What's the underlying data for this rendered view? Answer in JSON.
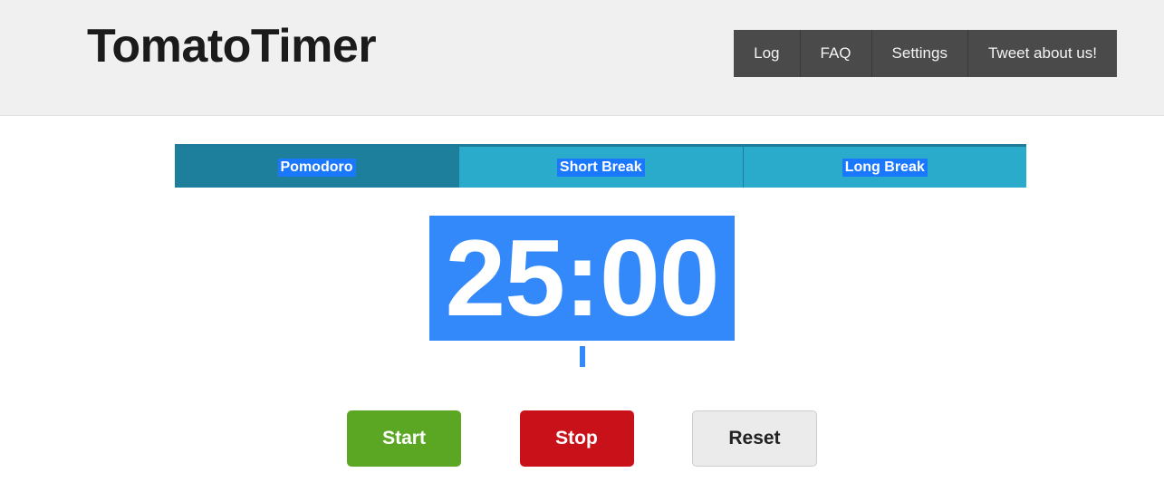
{
  "header": {
    "brand_title": "TomatoTimer",
    "background_color": "#f0f0f0",
    "nav": {
      "background_color": "#4a4a4a",
      "items": [
        {
          "label": "Log",
          "name": "log"
        },
        {
          "label": "FAQ",
          "name": "faq"
        },
        {
          "label": "Settings",
          "name": "settings"
        },
        {
          "label": "Tweet about us!",
          "name": "tweet-about-us"
        }
      ]
    }
  },
  "main": {
    "tabs": [
      {
        "label": "Pomodoro",
        "active": true,
        "color": "#1d7f9c"
      },
      {
        "label": "Short Break",
        "active": false,
        "color": "#2aabcc"
      },
      {
        "label": "Long Break",
        "active": false,
        "color": "#2aabcc"
      }
    ],
    "timer": {
      "display": "25:00",
      "minutes": "25",
      "seconds": "00",
      "highlight_color": "#3388fa",
      "text_color": "#ffffff"
    },
    "controls": [
      {
        "label": "Start",
        "name": "start",
        "color": "#5ba623",
        "text_color": "#ffffff"
      },
      {
        "label": "Stop",
        "name": "stop",
        "color": "#c91119",
        "text_color": "#ffffff"
      },
      {
        "label": "Reset",
        "name": "reset",
        "color": "#ebebeb",
        "text_color": "#222222"
      }
    ]
  },
  "selection": {
    "highlight_color": "#1a78ff"
  }
}
